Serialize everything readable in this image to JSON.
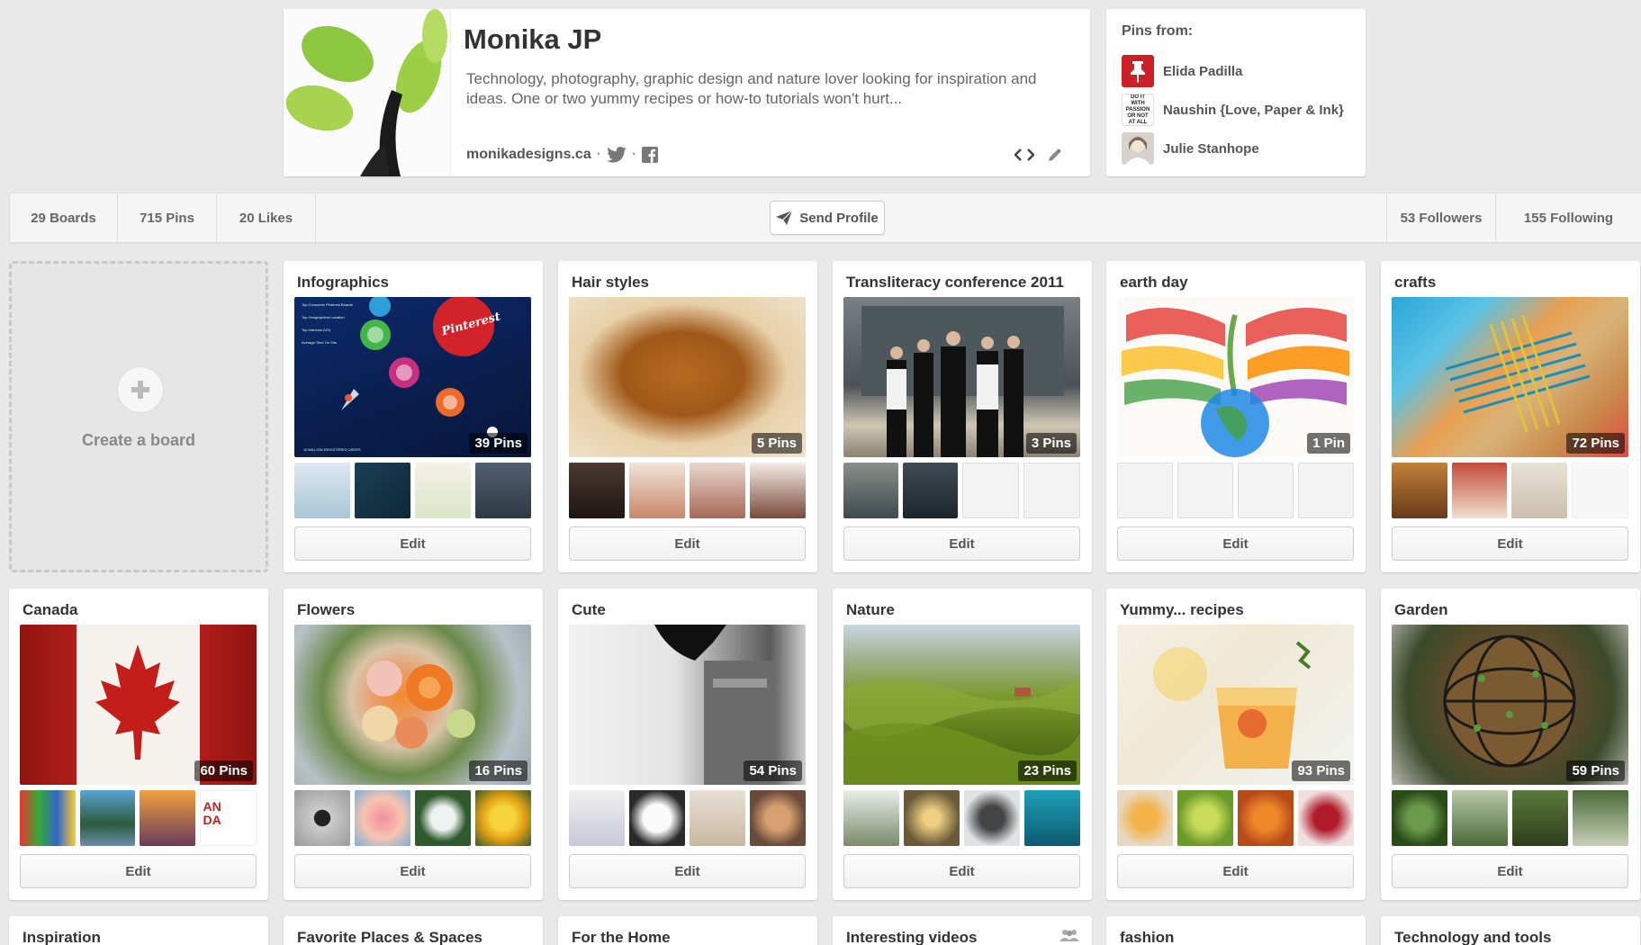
{
  "profile": {
    "name": "Monika JP",
    "about": "Technology, photography, graphic design and nature lover looking for inspiration and ideas. One or two yummy recipes or how-to tutorials won't hurt...",
    "website": "monikadesigns.ca",
    "separator": "·",
    "icons": [
      "twitter-icon",
      "facebook-icon",
      "embed-icon",
      "pencil-icon"
    ]
  },
  "pins_from": {
    "title": "Pins from:",
    "sources": [
      {
        "name": "Elida Padilla",
        "icon": "pushpin-icon"
      },
      {
        "name": "Naushin {Love, Paper & Ink}",
        "thumb_text": "DO IT WITH PASSION OR NOT AT ALL"
      },
      {
        "name": "Julie Stanhope",
        "icon": "avatar"
      }
    ]
  },
  "stats": {
    "boards": "29 Boards",
    "pins": "715 Pins",
    "likes": "20 Likes",
    "send_profile": "Send Profile",
    "followers": "53 Followers",
    "following": "155 Following"
  },
  "create_board": {
    "label": "Create a board"
  },
  "edit_label": "Edit",
  "boards": [
    {
      "title": "Infographics",
      "count": "39 Pins",
      "cover_text": "Pinterest",
      "cover_lines": [
        "Top Consumer Pinterest Boards",
        "Top Geographical Location",
        "Top Interests (US)",
        "Average Time On Site",
        "10 MILLION REGISTERED USERS"
      ]
    },
    {
      "title": "Hair styles",
      "count": "5 Pins"
    },
    {
      "title": "Transliteracy conference 2011",
      "count": "3 Pins"
    },
    {
      "title": "earth day",
      "count": "1 Pin"
    },
    {
      "title": "crafts",
      "count": "72 Pins"
    },
    {
      "title": "Canada",
      "count": "60 Pins",
      "thumb_text": "AN\nDA"
    },
    {
      "title": "Flowers",
      "count": "16 Pins"
    },
    {
      "title": "Cute",
      "count": "54 Pins"
    },
    {
      "title": "Nature",
      "count": "23 Pins"
    },
    {
      "title": "Yummy... recipes",
      "count": "93 Pins"
    },
    {
      "title": "Garden",
      "count": "59 Pins"
    },
    {
      "title": "Inspiration"
    },
    {
      "title": "Favorite Places & Spaces"
    },
    {
      "title": "For the Home"
    },
    {
      "title": "Interesting videos"
    },
    {
      "title": "fashion"
    },
    {
      "title": "Technology and tools"
    }
  ]
}
